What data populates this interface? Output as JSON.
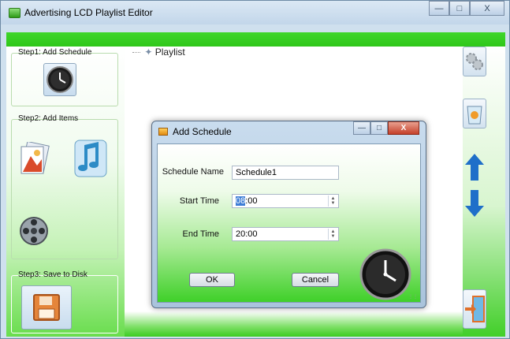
{
  "window": {
    "title": "Advertising LCD Playlist Editor",
    "controls": [
      "minimize",
      "maximize",
      "close"
    ],
    "close_glyph": "X"
  },
  "left_panel": {
    "step1_label": "Step1: Add Schedule",
    "step2_label": "Step2: Add Items",
    "step3_label": "Step3: Save to Disk"
  },
  "tree": {
    "root_label": "Playlist"
  },
  "right_panel": {
    "buttons": [
      "settings-gear-icon",
      "recycle-bin-icon",
      "move-up-arrow-icon",
      "move-down-arrow-icon",
      "exit-door-icon"
    ]
  },
  "dialog": {
    "title": "Add Schedule",
    "schedule_name_label": "Schedule Name",
    "schedule_name_value": "Schedule1",
    "start_time_label": "Start Time",
    "start_time_hour": "08",
    "start_time_rest": ":00",
    "end_time_label": "End Time",
    "end_time_value": "20:00",
    "ok_label": "OK",
    "cancel_label": "Cancel"
  },
  "colors": {
    "accent_green": "#2fc71a",
    "selection_blue": "#3f7ed6"
  }
}
